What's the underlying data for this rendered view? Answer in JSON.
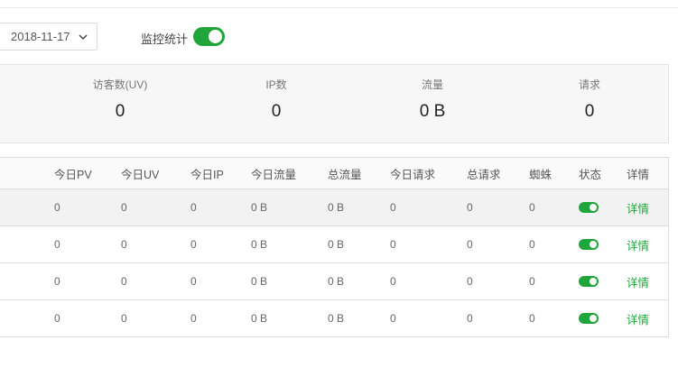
{
  "filter": {
    "date": "2018-11-17",
    "monitor_label": "监控统计",
    "monitor_enabled": true
  },
  "summary": [
    {
      "label": "访客数(UV)",
      "value": "0"
    },
    {
      "label": "IP数",
      "value": "0"
    },
    {
      "label": "流量",
      "value": "0 B"
    },
    {
      "label": "请求",
      "value": "0"
    }
  ],
  "table": {
    "headers": [
      "今日PV",
      "今日UV",
      "今日IP",
      "今日流量",
      "总流量",
      "今日请求",
      "总请求",
      "蜘蛛",
      "状态",
      "详情"
    ],
    "rows": [
      {
        "pv": "0",
        "uv": "0",
        "ip": "0",
        "traffic": "0 B",
        "total_traffic": "0 B",
        "requests": "0",
        "total_requests": "0",
        "spider": "0",
        "status": true,
        "detail": "详情"
      },
      {
        "pv": "0",
        "uv": "0",
        "ip": "0",
        "traffic": "0 B",
        "total_traffic": "0 B",
        "requests": "0",
        "total_requests": "0",
        "spider": "0",
        "status": true,
        "detail": "详情"
      },
      {
        "pv": "0",
        "uv": "0",
        "ip": "0",
        "traffic": "0 B",
        "total_traffic": "0 B",
        "requests": "0",
        "total_requests": "0",
        "spider": "0",
        "status": true,
        "detail": "详情"
      },
      {
        "pv": "0",
        "uv": "0",
        "ip": "0",
        "traffic": "0 B",
        "total_traffic": "0 B",
        "requests": "0",
        "total_requests": "0",
        "spider": "0",
        "status": true,
        "detail": "详情"
      }
    ]
  },
  "colors": {
    "accent_green": "#20a53a"
  },
  "icons": {
    "date_dropdown": "chevron-down-icon"
  }
}
